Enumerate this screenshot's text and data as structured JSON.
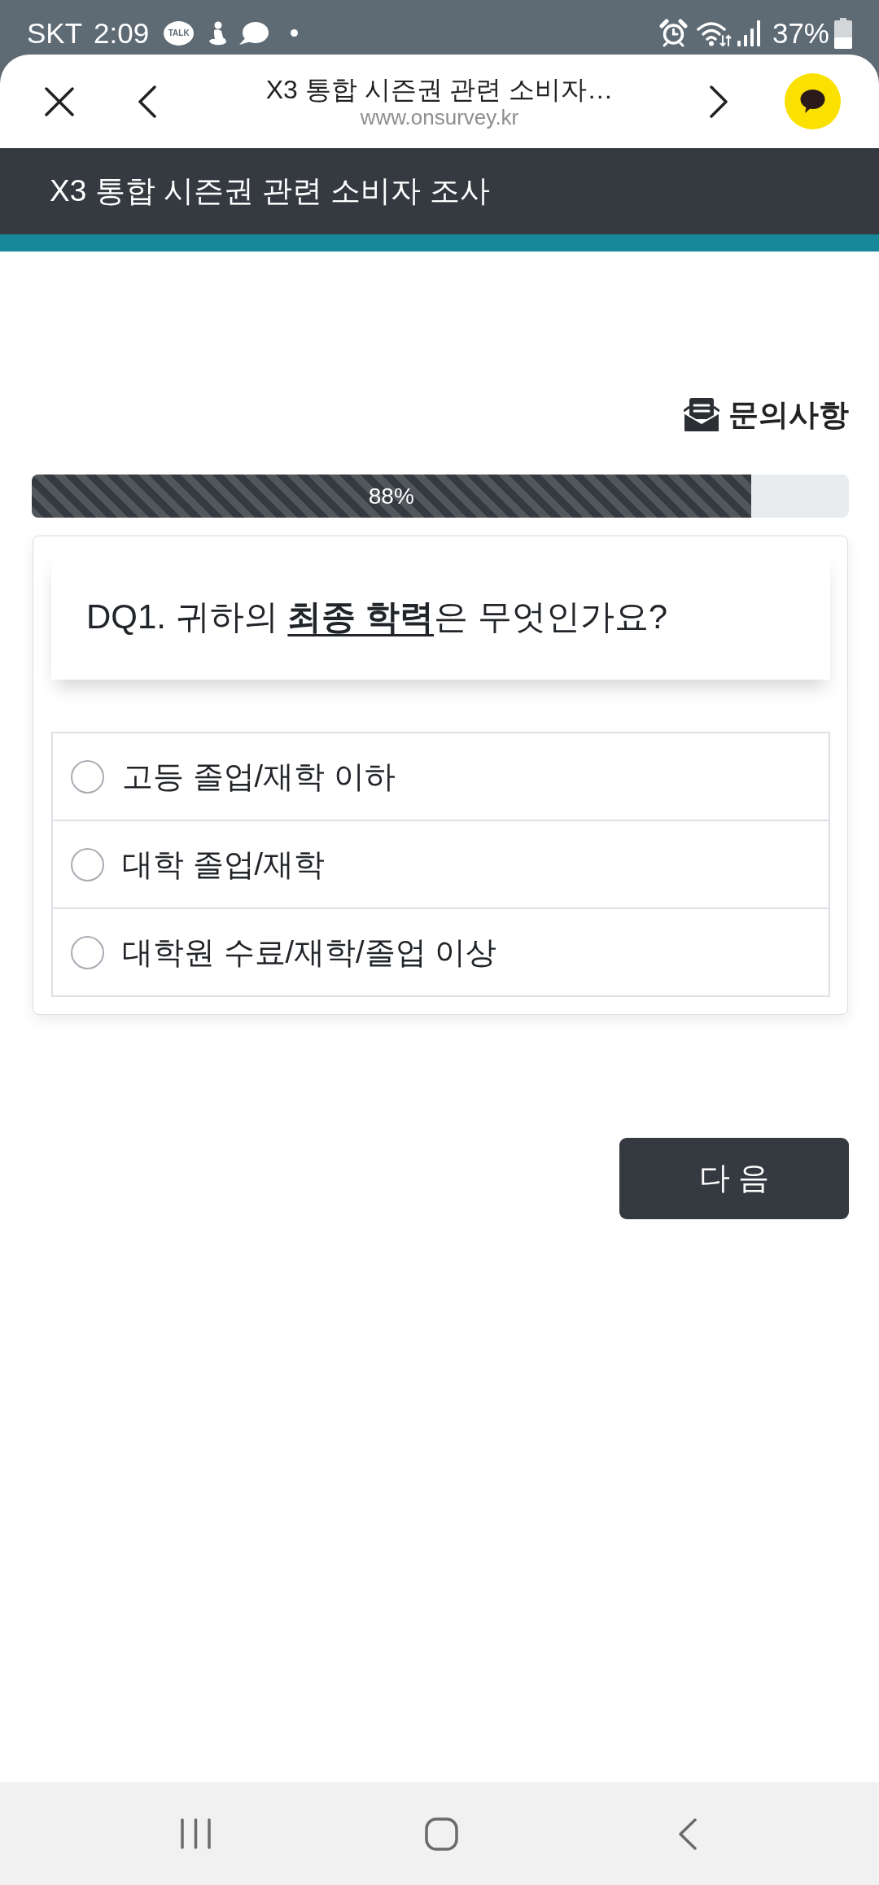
{
  "status_bar": {
    "carrier": "SKT",
    "time": "2:09",
    "notification_badge": "TALK",
    "battery": "37%"
  },
  "browser_bar": {
    "title": "X3 통합 시즌권 관련 소비자…",
    "url": "www.onsurvey.kr"
  },
  "survey_header": {
    "title": "X3 통합 시즌권 관련 소비자 조사"
  },
  "contact_link": {
    "label": "문의사항"
  },
  "progress": {
    "level": 0.88,
    "label": "88%"
  },
  "question": {
    "text": "DQ1. 귀하의 **최종 학력**은 무엇인가요?",
    "options": [
      {
        "label": "고등 졸업/재학 이하",
        "selected": false
      },
      {
        "label": "대학 졸업/재학",
        "selected": false
      },
      {
        "label": "대학원 수료/재학/졸업 이상",
        "selected": false
      }
    ]
  },
  "next_button": {
    "label": "다 음"
  }
}
